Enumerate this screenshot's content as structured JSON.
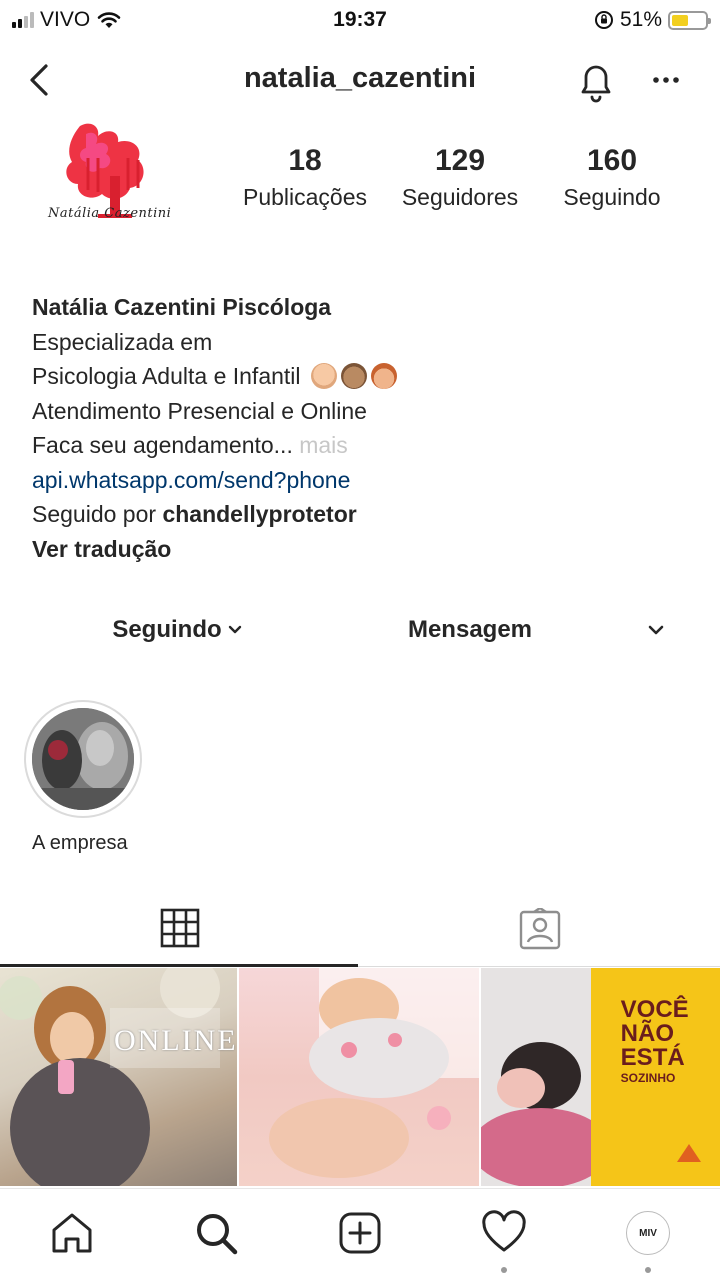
{
  "status_bar": {
    "carrier": "VIVO",
    "time": "19:37",
    "battery_percent": "51%",
    "battery_level": 0.51,
    "icons": [
      "signal-icon",
      "wifi-icon",
      "orientation-lock-icon",
      "battery-icon"
    ]
  },
  "header": {
    "username": "natalia_cazentini",
    "icons": [
      "back-arrow-icon",
      "bell-icon",
      "more-icon"
    ]
  },
  "profile": {
    "logo_text": "Natália Cazentini",
    "stats": {
      "posts": {
        "value": "18",
        "label": "Publicações"
      },
      "followers": {
        "value": "129",
        "label": "Seguidores"
      },
      "following": {
        "value": "160",
        "label": "Seguindo"
      }
    }
  },
  "bio": {
    "name": "Natália Cazentini Piscóloga",
    "line1": "Especializada em",
    "line2": "Psicologia Adulta e Infantil",
    "emojis": [
      "baby-emoji",
      "boy-emoji",
      "woman-emoji"
    ],
    "line3": "Atendimento Presencial e Online",
    "line4": "Faca seu agendamento...",
    "more": " mais",
    "link": "api.whatsapp.com/send?phone",
    "followed_by_prefix": "Seguido por ",
    "followed_by_user": "chandellyprotetor",
    "translate": "Ver tradução"
  },
  "actions": {
    "following_label": "Seguindo",
    "message_label": "Mensagem"
  },
  "highlights": [
    {
      "label": "A empresa"
    }
  ],
  "tabs": {
    "active": "grid",
    "icons": [
      "grid-icon",
      "tagged-icon"
    ]
  },
  "posts": [
    {
      "text": "ONLINE",
      "accent": "#ef8fb2"
    },
    {
      "text": "",
      "accent": "#f2a6b3"
    },
    {
      "text_line1": "VOCÊ",
      "text_line2": "NÃO",
      "text_line3": "ESTÁ",
      "text_line4": "SOZINHO",
      "accent": "#f5c518"
    }
  ],
  "bottom_nav": {
    "profile_avatar_text": "MIV",
    "icons": [
      "home-icon",
      "search-icon",
      "new-post-icon",
      "activity-heart-icon",
      "profile-avatar-icon"
    ]
  },
  "colors": {
    "text": "#262626",
    "link": "#00376b",
    "muted": "#c7c7c7",
    "logo_red": "#e8283c",
    "logo_pink": "#f1488a"
  }
}
